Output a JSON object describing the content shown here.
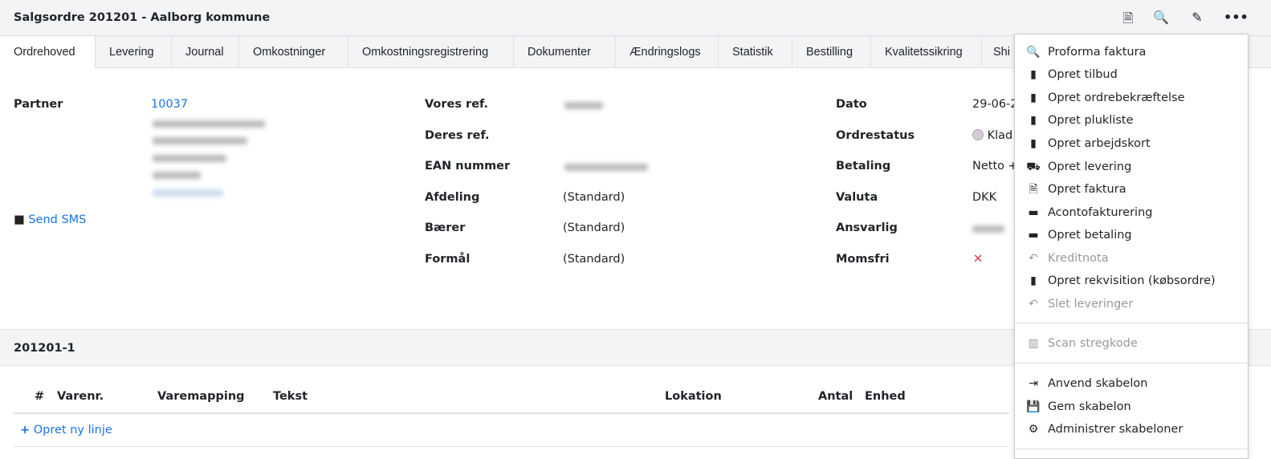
{
  "header": {
    "title": "Salgsordre 201201 - Aalborg kommune",
    "icons": [
      "document-icon",
      "document-search-icon",
      "edit-icon",
      "more-icon"
    ]
  },
  "tabs": [
    "Ordrehoved",
    "Levering",
    "Journal",
    "Omkostninger",
    "Omkostningsregistrering",
    "Dokumenter",
    "Ændringslogs",
    "Statistik",
    "Bestilling",
    "Kvalitetssikring",
    "Shi"
  ],
  "partner": {
    "label": "Partner",
    "number": "10037",
    "send_sms": "Send SMS"
  },
  "middle": [
    {
      "label": "Vores ref.",
      "value": ""
    },
    {
      "label": "Deres ref.",
      "value": ""
    },
    {
      "label": "EAN nummer",
      "value": ""
    },
    {
      "label": "Afdeling",
      "value": "(Standard)"
    },
    {
      "label": "Bærer",
      "value": "(Standard)"
    },
    {
      "label": "Formål",
      "value": "(Standard)"
    }
  ],
  "right": [
    {
      "label": "Dato",
      "value": "29-06-2"
    },
    {
      "label": "Ordrestatus",
      "value": "Klad"
    },
    {
      "label": "Betaling",
      "value": "Netto +"
    },
    {
      "label": "Valuta",
      "value": "DKK"
    },
    {
      "label": "Ansvarlig",
      "value": ""
    },
    {
      "label": "Momsfri",
      "value": "✕"
    }
  ],
  "colors": {
    "accent": "#1a73e8",
    "danger": "#dc3545",
    "status_dot": "#d8c8dc"
  },
  "lines": {
    "title": "201201-1",
    "columns": [
      "#",
      "Varenr.",
      "Varemapping",
      "Tekst",
      "Lokation",
      "Antal",
      "Enhed"
    ],
    "add_line": "Opret ny linje"
  },
  "menu": [
    {
      "label": "Proforma faktura",
      "icon": "document-search-icon",
      "disabled": false
    },
    {
      "label": "Opret tilbud",
      "icon": "file-plus-icon",
      "disabled": false
    },
    {
      "label": "Opret ordrebekræftelse",
      "icon": "file-plus-icon",
      "disabled": false
    },
    {
      "label": "Opret plukliste",
      "icon": "file-plus-icon",
      "disabled": false
    },
    {
      "label": "Opret arbejdskort",
      "icon": "file-plus-icon",
      "disabled": false
    },
    {
      "label": "Opret levering",
      "icon": "truck-icon",
      "disabled": false
    },
    {
      "label": "Opret faktura",
      "icon": "invoice-icon",
      "disabled": false
    },
    {
      "label": "Acontofakturering",
      "icon": "credit-card-icon",
      "disabled": false
    },
    {
      "label": "Opret betaling",
      "icon": "credit-card-icon",
      "disabled": false
    },
    {
      "label": "Kreditnota",
      "icon": "undo-icon",
      "disabled": true
    },
    {
      "label": "Opret rekvisition (købsordre)",
      "icon": "file-plus-icon",
      "disabled": false
    },
    {
      "label": "Slet leveringer",
      "icon": "undo-icon",
      "disabled": true
    },
    {
      "label": "Scan stregkode",
      "icon": "barcode-scanner-icon",
      "disabled": true
    },
    {
      "label": "Anvend skabelon",
      "icon": "file-import-icon",
      "disabled": false
    },
    {
      "label": "Gem skabelon",
      "icon": "save-icon",
      "disabled": false
    },
    {
      "label": "Administrer skabeloner",
      "icon": "gear-icon",
      "disabled": false
    }
  ]
}
